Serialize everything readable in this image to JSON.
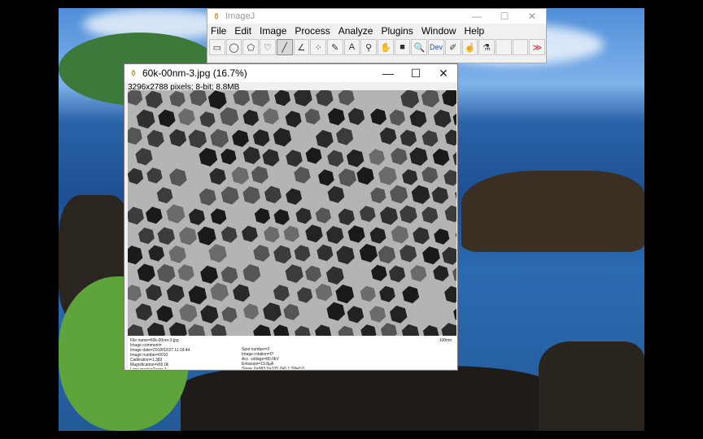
{
  "imagej": {
    "title": "ImageJ",
    "menu": [
      "File",
      "Edit",
      "Image",
      "Process",
      "Analyze",
      "Plugins",
      "Window",
      "Help"
    ],
    "tools": [
      {
        "name": "rectangle-tool-icon",
        "glyph": "▭"
      },
      {
        "name": "oval-tool-icon",
        "glyph": "◯"
      },
      {
        "name": "polygon-tool-icon",
        "glyph": "⬠"
      },
      {
        "name": "freehand-tool-icon",
        "glyph": "♡"
      },
      {
        "name": "line-tool-icon",
        "glyph": "╱"
      },
      {
        "name": "angle-tool-icon",
        "glyph": "∠"
      },
      {
        "name": "point-tool-icon",
        "glyph": "⁘"
      },
      {
        "name": "wand-tool-icon",
        "glyph": "✎"
      },
      {
        "name": "text-tool-icon",
        "glyph": "A"
      },
      {
        "name": "magnifier-tool-icon",
        "glyph": "⚲"
      },
      {
        "name": "hand-tool-icon",
        "glyph": "✋"
      },
      {
        "name": "color-picker-icon",
        "glyph": "■"
      },
      {
        "name": "search-tool-icon",
        "glyph": "🔍"
      },
      {
        "name": "dev-tool-icon",
        "glyph": "Dev"
      },
      {
        "name": "pencil-tool-icon",
        "glyph": "✐"
      },
      {
        "name": "brush-tool-icon",
        "glyph": "☝"
      },
      {
        "name": "pipette-tool-icon",
        "glyph": "⚗"
      },
      {
        "name": "blank-tool-1",
        "glyph": ""
      },
      {
        "name": "blank-tool-2",
        "glyph": ""
      },
      {
        "name": "more-tools-icon",
        "glyph": "≫"
      }
    ]
  },
  "image_window": {
    "title": "60k-00nm-3.jpg (16.7%)",
    "info": "3296x2788 pixels; 8-bit; 8.8MB",
    "caption_left": [
      "File name=60k-00nm-3.jpg",
      "Image comment=",
      "Image date=2018/02/27 11:18:44",
      "Image number=0010",
      "Calibration=1.383",
      "Magnification=x60.0k",
      "Lens mode=Zoom-1"
    ],
    "caption_mid": [
      "Spot number=3",
      "Image rotation=0°",
      "Acc. voltage=80.0kV",
      "Emission=19.8µA",
      "Stage X=983 Y=105 Z=0.1 Tilt=0.0"
    ],
    "scale_label": "100nm"
  },
  "window_controls": {
    "minimize": "—",
    "maximize": "☐",
    "close": "✕"
  }
}
